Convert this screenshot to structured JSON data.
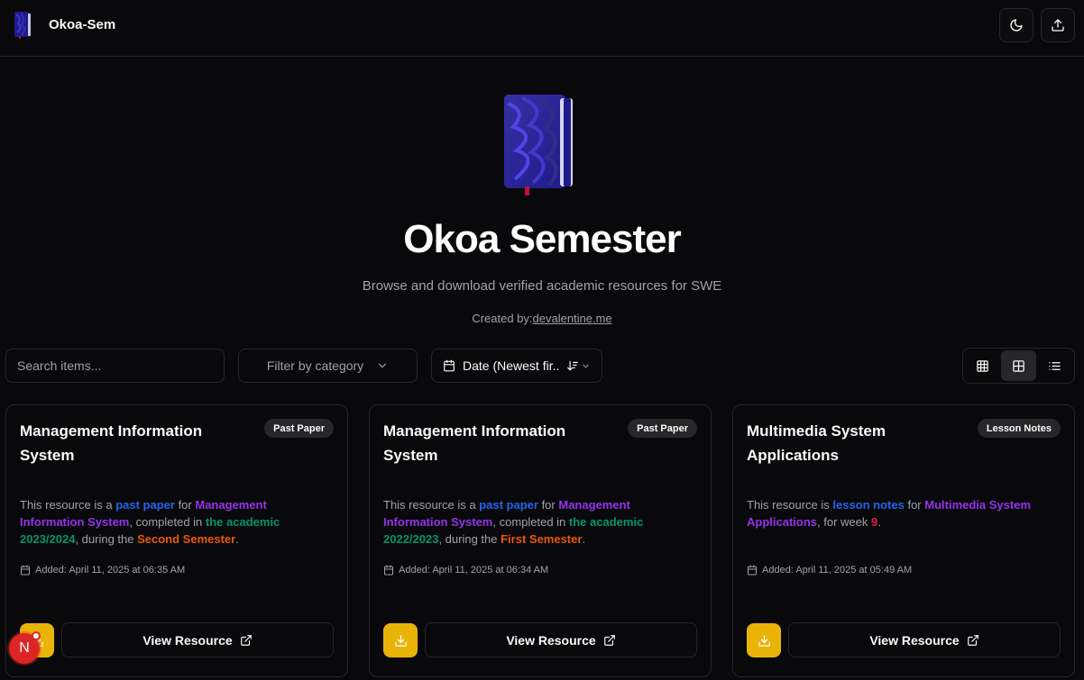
{
  "header": {
    "brand_name": "Okoa-Sem",
    "theme_toggle_icon": "moon-icon",
    "upload_icon": "upload-icon"
  },
  "hero": {
    "title": "Okoa Semester",
    "subtitle": "Browse and download verified academic resources for SWE",
    "credit_prefix": "Created by:",
    "credit_link": "devalentine.me"
  },
  "toolbar": {
    "search_placeholder": "Search items...",
    "category_label": "Filter by category",
    "sort_label": "Date (Newest fir...",
    "view_modes": [
      "grid-small",
      "grid-large",
      "list"
    ],
    "active_view": "grid-large"
  },
  "cards": [
    {
      "title": "Management Information System",
      "badge": "Past Paper",
      "desc": {
        "p1": "This resource is a ",
        "type": "past paper",
        "p2": " for ",
        "subject": "Management Information System",
        "p3": ", completed in ",
        "year": "the academic 2023/2024",
        "p4": ", during the ",
        "semester": "Second Semester",
        "p5": "."
      },
      "date": "Added: April 11, 2025 at 06:35 AM",
      "view_label": "View Resource"
    },
    {
      "title": "Management Information System",
      "badge": "Past Paper",
      "desc": {
        "p1": "This resource is a ",
        "type": "past paper",
        "p2": " for ",
        "subject": "Management Information System",
        "p3": ", completed in ",
        "year": "the academic 2022/2023",
        "p4": ", during the ",
        "semester": "First Semester",
        "p5": "."
      },
      "date": "Added: April 11, 2025 at 06:34 AM",
      "view_label": "View Resource"
    },
    {
      "title": "Multimedia System Applications",
      "badge": "Lesson Notes",
      "desc": {
        "p1": "This resource is ",
        "type": "lesson notes",
        "p2": " for ",
        "subject": "Multimedia System Applications",
        "p3": ", for week ",
        "week": "9",
        "p4": "."
      },
      "date": "Added: April 11, 2025 at 05:49 AM",
      "view_label": "View Resource"
    }
  ],
  "dev_indicator": {
    "letter": "N"
  },
  "colors": {
    "background": "#09090b",
    "border": "#27272a",
    "accent_yellow": "#eab308",
    "type_blue": "#2563eb",
    "subject_purple": "#9333ea",
    "year_green": "#059669",
    "semester_orange": "#ea580c",
    "week_red": "#e11d48"
  }
}
